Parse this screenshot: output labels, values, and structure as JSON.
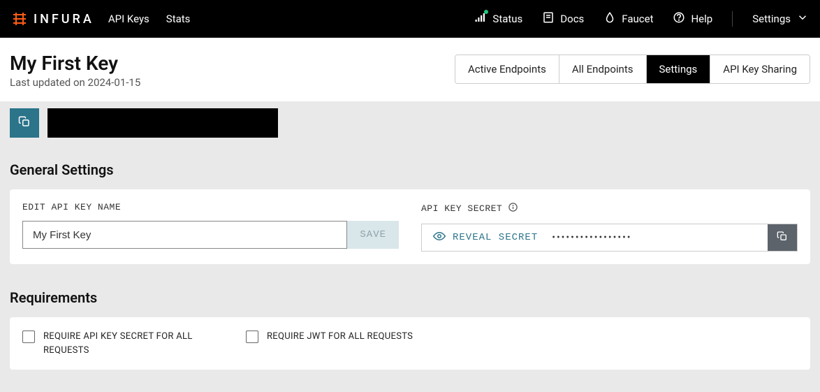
{
  "brand": {
    "name": "INFURA"
  },
  "nav": {
    "left": [
      "API Keys",
      "Stats"
    ],
    "right": [
      {
        "label": "Status",
        "icon": "signal-icon"
      },
      {
        "label": "Docs",
        "icon": "book-icon"
      },
      {
        "label": "Faucet",
        "icon": "drop-icon"
      },
      {
        "label": "Help",
        "icon": "help-icon"
      }
    ],
    "settings": "Settings"
  },
  "header": {
    "title": "My First Key",
    "subtitle": "Last updated on 2024-01-15"
  },
  "tabs": [
    {
      "label": "Active Endpoints",
      "active": false
    },
    {
      "label": "All Endpoints",
      "active": false
    },
    {
      "label": "Settings",
      "active": true
    },
    {
      "label": "API Key Sharing",
      "active": false
    }
  ],
  "general": {
    "heading": "General Settings",
    "name_label": "EDIT API KEY NAME",
    "name_value": "My First Key",
    "save_label": "SAVE",
    "secret_label": "API KEY SECRET",
    "reveal_label": "REVEAL SECRET",
    "secret_mask": "•••••••••••••••••"
  },
  "requirements": {
    "heading": "Requirements",
    "items": [
      {
        "label": "REQUIRE API KEY SECRET FOR ALL REQUESTS"
      },
      {
        "label": "REQUIRE JWT FOR ALL REQUESTS"
      }
    ]
  }
}
